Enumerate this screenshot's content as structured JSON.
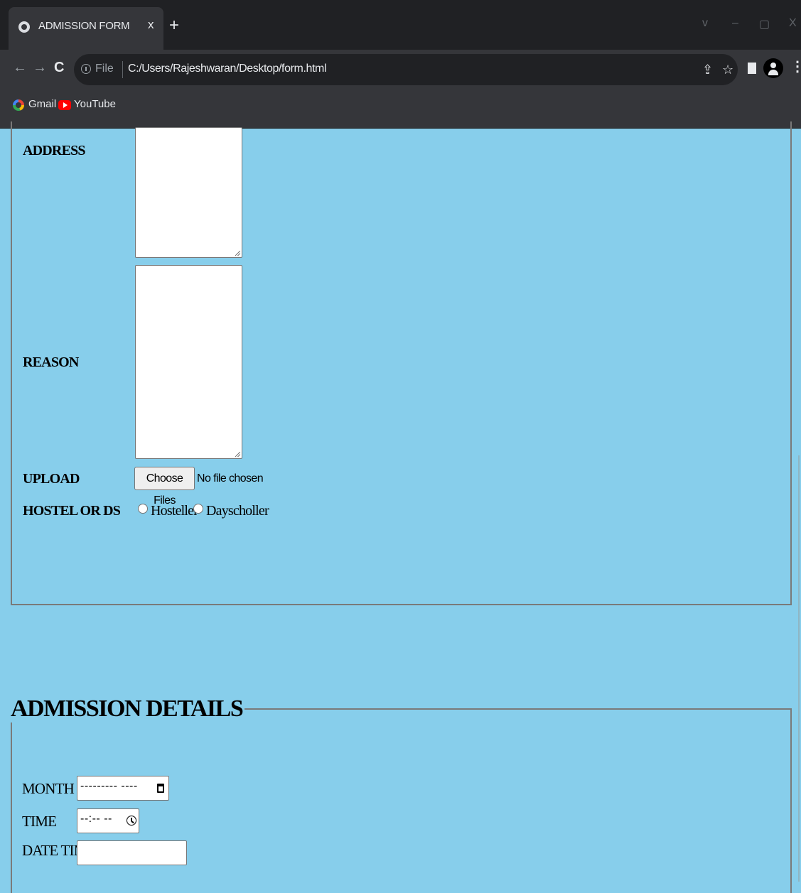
{
  "browser": {
    "tab_title": "ADMISSION FORM",
    "tab_close": "x",
    "new_tab": "+",
    "window_controls": [
      "v",
      "–",
      "▢",
      "X"
    ],
    "nav": {
      "back": "←",
      "forward": "→",
      "reload": "C"
    },
    "address_bar": {
      "scheme_label": "File",
      "url": "C:/Users/Rajeshwaran/Desktop/form.html"
    },
    "icons": {
      "share": "⇪",
      "bookmark_star": "☆",
      "menu": "⋮"
    },
    "bookmarks": [
      {
        "label": "Gmail",
        "icon": "google-icon"
      },
      {
        "label": "YouTube",
        "icon": "youtube-icon"
      }
    ]
  },
  "form": {
    "address_label": "ADDRESS",
    "reason_label": "REASON",
    "upload_label": "UPLOAD",
    "upload_button": "Choose Files",
    "upload_status": "No file chosen",
    "hostel_label": "HOSTEL OR DS",
    "hostel_options": [
      "Hosteller",
      "Dayscholler"
    ]
  },
  "admission": {
    "legend": "ADMISSION DETAILS",
    "month_label": "MONTH",
    "month_value": "--------- ----",
    "time_label": "TIME",
    "time_value": "--:-- --",
    "datetime_label": "DATE TIME"
  }
}
